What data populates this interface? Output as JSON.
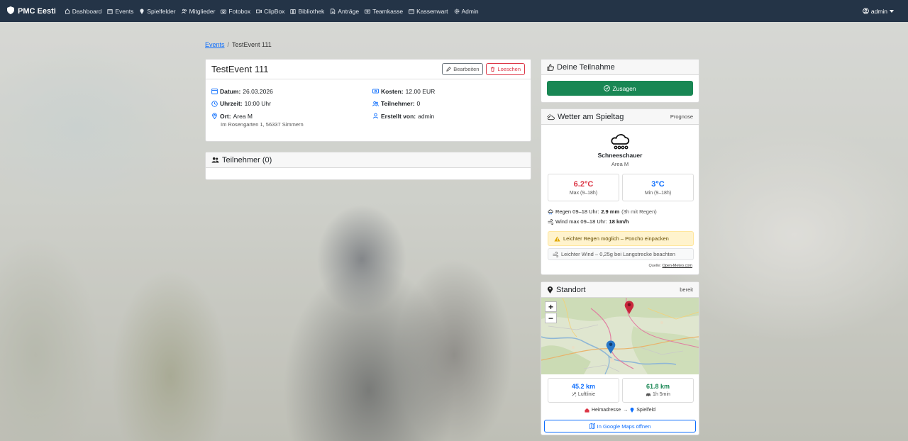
{
  "navbar": {
    "brand": "PMC Eesti",
    "items": [
      {
        "label": "Dashboard",
        "icon": "house-icon"
      },
      {
        "label": "Events",
        "icon": "calendar-icon"
      },
      {
        "label": "Spielfelder",
        "icon": "map-pin-icon"
      },
      {
        "label": "Mitglieder",
        "icon": "people-icon"
      },
      {
        "label": "Fotobox",
        "icon": "camera-icon"
      },
      {
        "label": "ClipBox",
        "icon": "video-icon"
      },
      {
        "label": "Bibliothek",
        "icon": "book-icon"
      },
      {
        "label": "Anträge",
        "icon": "document-icon"
      },
      {
        "label": "Teamkasse",
        "icon": "cash-icon"
      },
      {
        "label": "Kassenwart",
        "icon": "wallet-icon"
      },
      {
        "label": "Admin",
        "icon": "gear-icon"
      }
    ],
    "user": "admin"
  },
  "breadcrumb": {
    "parent": "Events",
    "current": "TestEvent 111"
  },
  "event": {
    "title": "TestEvent 111",
    "edit_label": "Bearbeiten",
    "delete_label": "Loeschen",
    "date_label": "Datum:",
    "date": "26.03.2026",
    "time_label": "Uhrzeit:",
    "time": "10:00 Uhr",
    "location_label": "Ort:",
    "location": "Area M",
    "address": "Im Rosengarten 1, 56337 Simmern",
    "cost_label": "Kosten:",
    "cost": "12.00 EUR",
    "participants_label": "Teilnehmer:",
    "participants": "0",
    "created_label": "Erstellt von:",
    "created_by": "admin"
  },
  "participants_card": {
    "title": "Teilnehmer (0)"
  },
  "teilnahme": {
    "title": "Deine Teilnahme",
    "button": "Zusagen"
  },
  "weather": {
    "title": "Wetter am Spieltag",
    "tag": "Prognose",
    "condition": "Schneeschauer",
    "location": "Area M",
    "max_value": "6.2°C",
    "max_label": "Max (9–18h)",
    "min_value": "3°C",
    "min_label": "Min (9–18h)",
    "rain_prefix": "Regen 09–18 Uhr:",
    "rain_value": "2.9 mm",
    "rain_note": "(3h mit Regen)",
    "wind_prefix": "Wind max 09–18 Uhr:",
    "wind_value": "18 km/h",
    "warning": "Leichter Regen möglich – Poncho einpacken",
    "wind_note": "Leichter Wind – 0,25g bei Langstrecke beachten",
    "source_prefix": "Quelle:",
    "source": "Open-Meteo.com",
    "colors": {
      "max": "#dc3545",
      "min": "#0d6efd"
    }
  },
  "standort": {
    "title": "Standort",
    "status": "bereit",
    "zoom_in": "+",
    "zoom_out": "−",
    "distance_air": "45.2 km",
    "distance_air_label": "Luftlinie",
    "distance_drive": "61.8 km",
    "distance_drive_label": "1h 5min",
    "route_from": "Heimadresse",
    "route_arrow": "→",
    "route_to": "Spielfeld",
    "button": "In Google Maps öffnen"
  }
}
